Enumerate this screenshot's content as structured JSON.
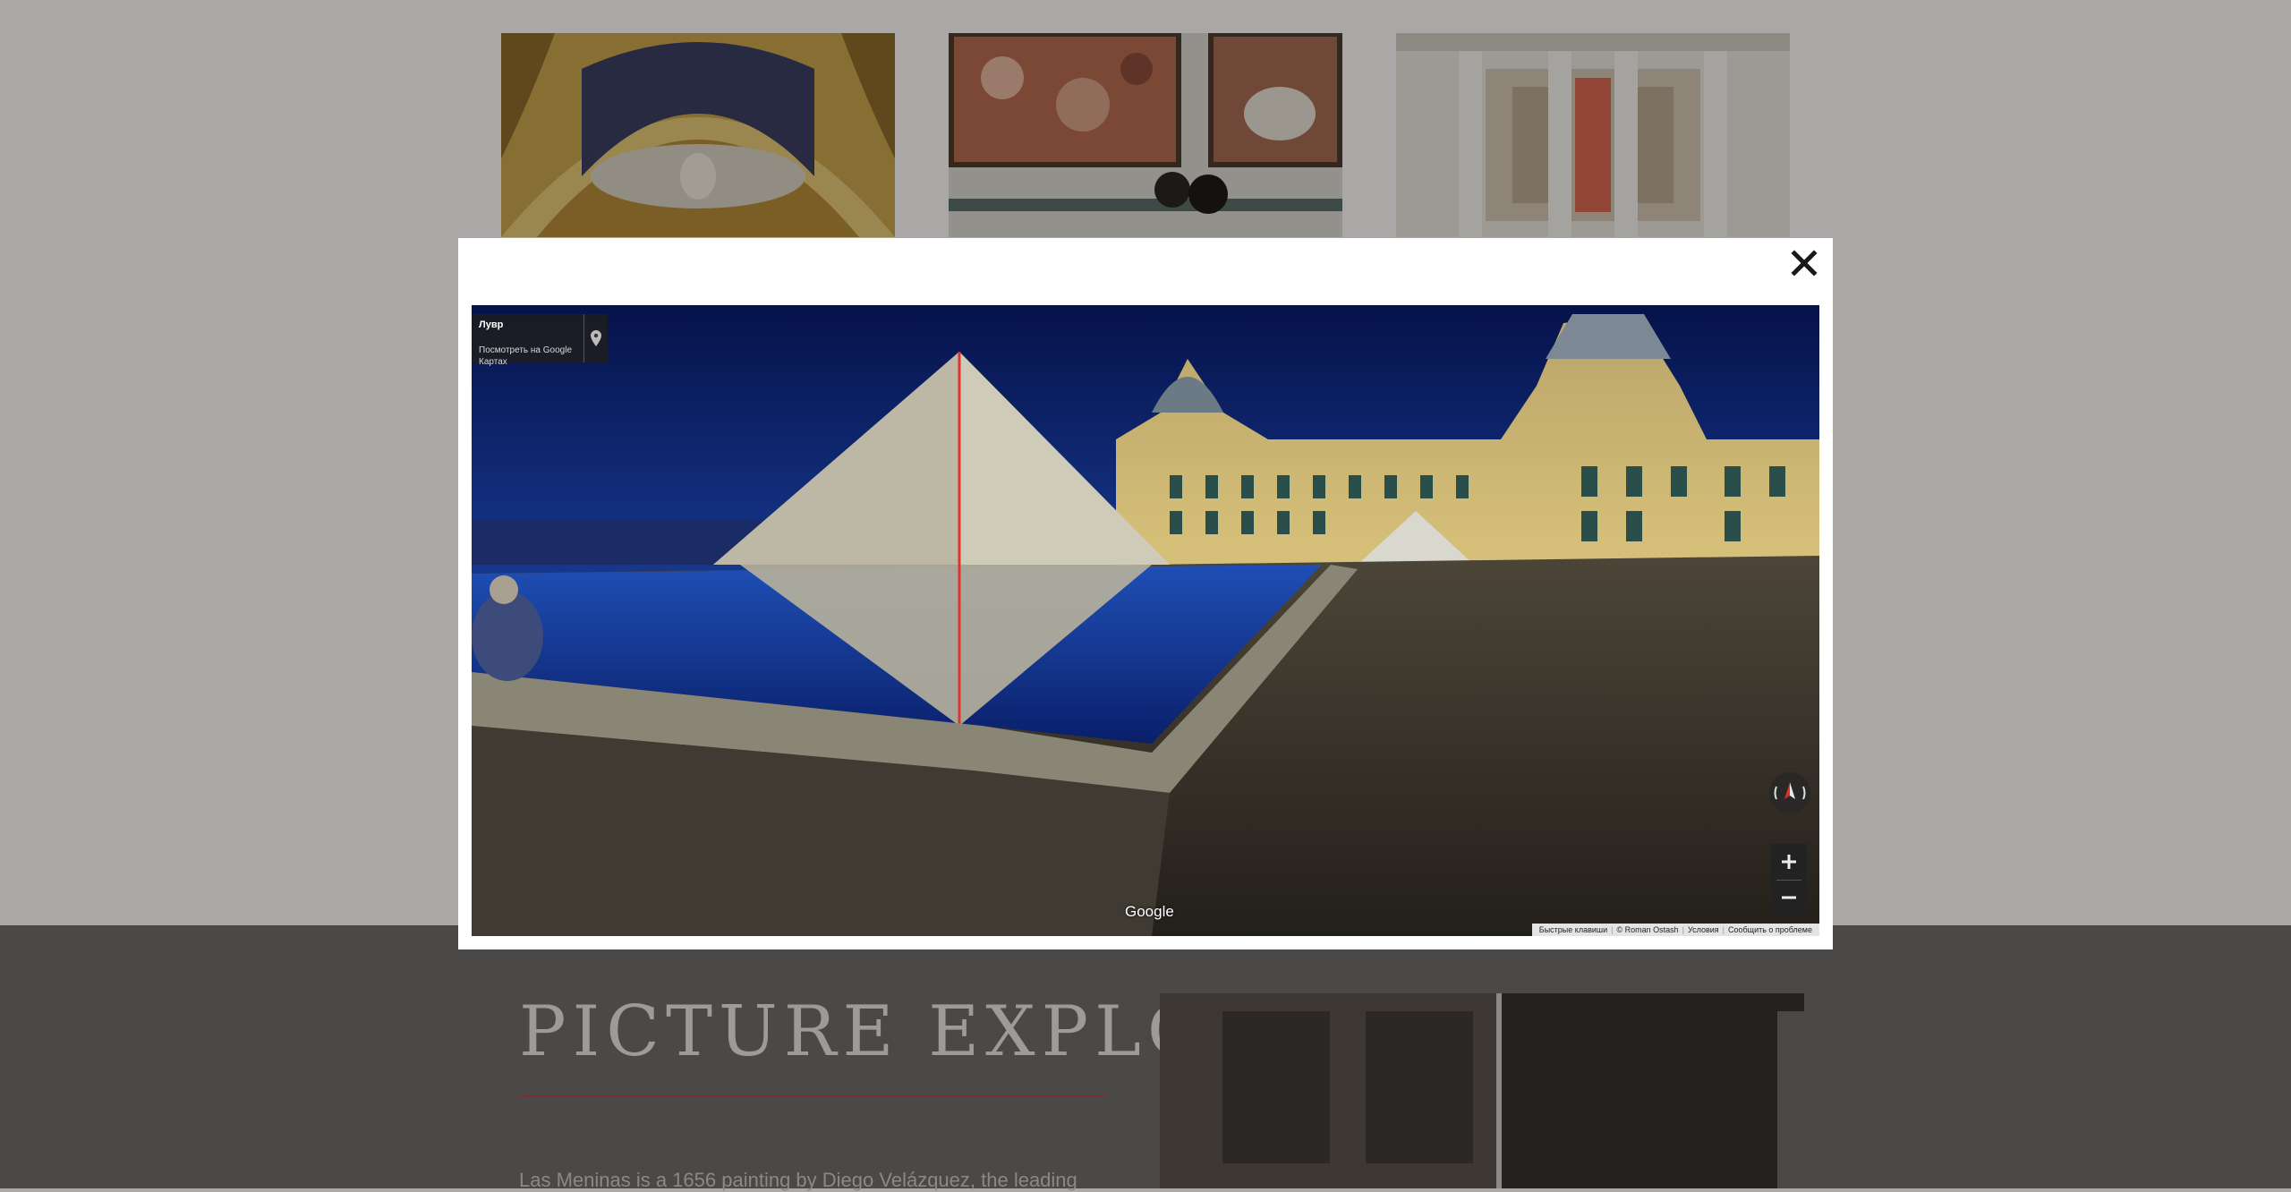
{
  "page": {
    "section_title": "PICTURE EXPLORE",
    "section_text": "Las Meninas is a 1656 painting by Diego Velázquez, the leading"
  },
  "gallery": {
    "thumbnails": [
      {
        "name": "ceiling-fresco"
      },
      {
        "name": "painting-hall"
      },
      {
        "name": "colonnade-hall"
      }
    ]
  },
  "modal": {
    "close_icon": "close-icon",
    "streetview": {
      "place_name": "Лувр",
      "place_link": "Посмотреть на Google Картах",
      "google_logo": "Google",
      "attribution": [
        "Быстрые клавиши",
        "© Roman Ostash",
        "Условия",
        "Сообщить о проблеме"
      ],
      "zoom_in_label": "+",
      "zoom_out_label": "−"
    }
  },
  "colors": {
    "accent_rule": "#7a2f30",
    "dark_section": "#4b4848"
  }
}
